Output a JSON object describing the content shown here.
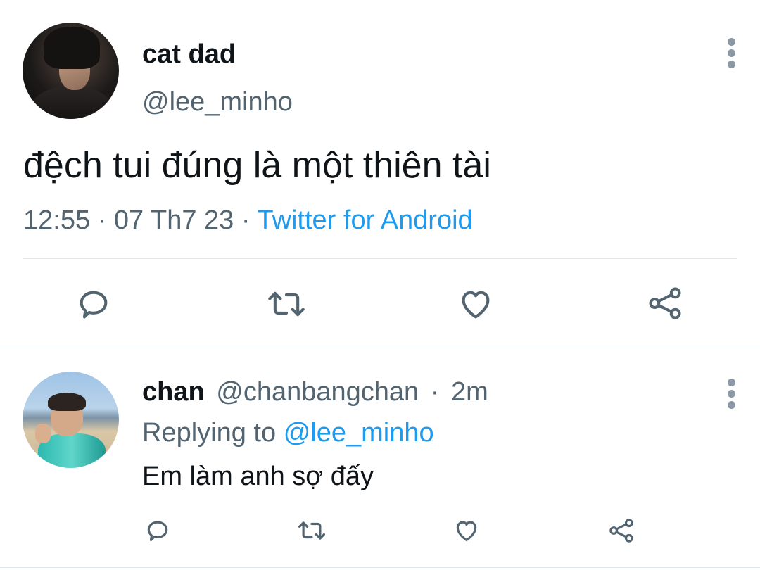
{
  "main_tweet": {
    "display_name": "cat dad",
    "handle": "@lee_minho",
    "text": "đệch tui đúng là một thiên tài",
    "time": "12:55",
    "date": "07 Th7 23",
    "separator": "·",
    "source": "Twitter for Android",
    "actions": [
      "reply-icon",
      "retweet-icon",
      "like-icon",
      "share-icon"
    ]
  },
  "reply": {
    "display_name": "chan",
    "handle": "@chanbangchan",
    "separator": "·",
    "age": "2m",
    "replying_prefix": "Replying to",
    "replying_mention": "@lee_minho",
    "text": "Em làm anh sợ đấy",
    "actions": [
      "reply-icon",
      "retweet-icon",
      "like-icon",
      "share-icon"
    ]
  },
  "colors": {
    "text_primary": "#0f1419",
    "text_secondary": "#536471",
    "link": "#1d9bf0",
    "icon": "#536471",
    "divider": "#e1e8ed"
  }
}
